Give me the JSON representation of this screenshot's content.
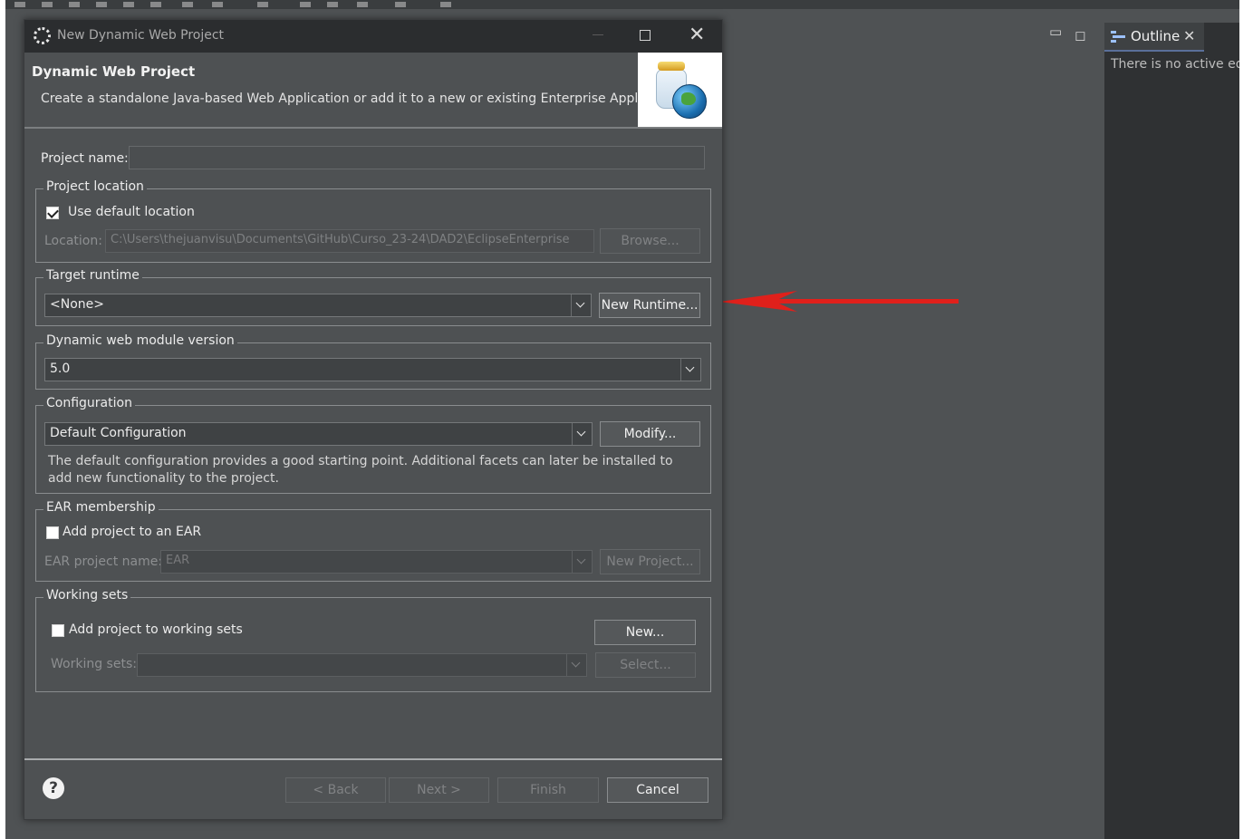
{
  "outline": {
    "tab_label": "Outline",
    "message": "There is no active edit"
  },
  "dialog": {
    "title": "New Dynamic Web Project",
    "header_title": "Dynamic Web Project",
    "header_desc": "Create a standalone Java-based Web Application or add it to a new or existing Enterprise Application.",
    "project_name_label": "Project name:",
    "project_name_value": "",
    "location_group": {
      "title": "Project location",
      "use_default_label": "Use default location",
      "use_default_checked": true,
      "location_label": "Location:",
      "location_value": "C:\\Users\\thejuanvisu\\Documents\\GitHub\\Curso_23-24\\DAD2\\EclipseEnterprise",
      "browse_label": "Browse..."
    },
    "runtime_group": {
      "title": "Target runtime",
      "selected": "<None>",
      "new_runtime_label": "New Runtime..."
    },
    "module_group": {
      "title": "Dynamic web module version",
      "selected": "5.0"
    },
    "config_group": {
      "title": "Configuration",
      "selected": "Default Configuration",
      "modify_label": "Modify...",
      "description": "The default configuration provides a good starting point. Additional facets can later be installed to add new functionality to the project."
    },
    "ear_group": {
      "title": "EAR membership",
      "add_label": "Add project to an EAR",
      "add_checked": false,
      "ear_name_label": "EAR project name:",
      "ear_name_value": "EAR",
      "new_project_label": "New Project..."
    },
    "working_sets_group": {
      "title": "Working sets",
      "add_label": "Add project to working sets",
      "add_checked": false,
      "new_label": "New...",
      "sets_label": "Working sets:",
      "sets_value": "",
      "select_label": "Select..."
    },
    "footer": {
      "help_icon": "?",
      "back_label": "< Back",
      "next_label": "Next >",
      "finish_label": "Finish",
      "cancel_label": "Cancel"
    }
  },
  "colors": {
    "workbench_bg": "#4f5254",
    "dialog_bg": "#4e5153",
    "titlebar_bg": "#2b2d2f",
    "arrow": "#e0201b"
  }
}
